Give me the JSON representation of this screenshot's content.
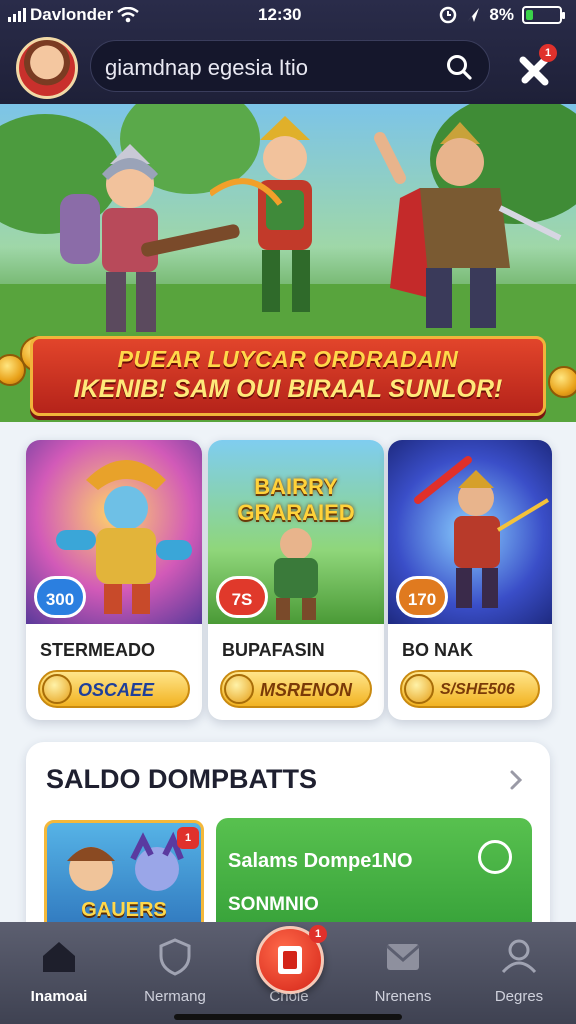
{
  "status_bar": {
    "carrier": "Davlonder",
    "time": "12:30",
    "battery": "8%",
    "battery_level": 0.08
  },
  "header": {
    "search_text": "giamdnap egesia Itio",
    "notification_count": "1"
  },
  "banner": {
    "line1": "PUEAR LUYCAR ORDRADAIN",
    "line2": "IKENIB! SAM OUI BIRAAL SUNLOR!"
  },
  "games": [
    {
      "badge": "300",
      "title": "STERMEADO",
      "price": "OSCAEE",
      "badge_color": "#2b7fe0"
    },
    {
      "badge": "7S",
      "title": "BUPAFASIN",
      "price": "MSRENON",
      "badge_color": "#e0392b",
      "art_title": "BAIRRY GRARAIED"
    },
    {
      "badge": "170",
      "title": "BO NAK",
      "price": "S/SHE506",
      "badge_color": "#e07a1f"
    }
  ],
  "section": {
    "title": "SALDO DOMPBATTS",
    "thumb_title": "GAUERS",
    "promo_line1": "Salams Dompe1NO",
    "promo_line2": "SONMNIO",
    "thumb_badge": "1"
  },
  "nav": {
    "items": [
      "Inamoai",
      "Nermang",
      "Cnole",
      "Nrenens",
      "Degres"
    ],
    "fab_badge": "1"
  }
}
